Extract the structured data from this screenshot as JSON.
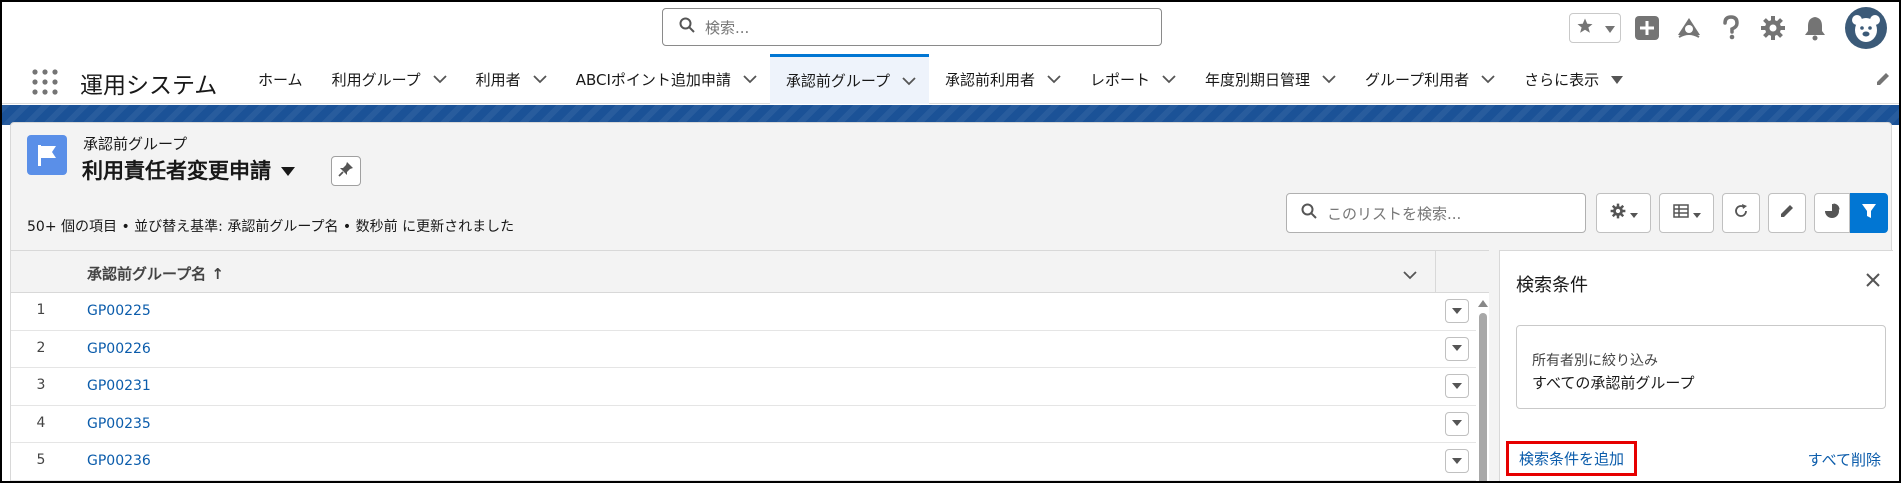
{
  "header": {
    "search_placeholder": "検索...",
    "icons": [
      "favorites-star-icon",
      "chevron-down-icon",
      "add-icon",
      "trailhead-icon",
      "help-icon",
      "setup-gear-icon",
      "notification-bell-icon",
      "avatar-icon"
    ]
  },
  "nav": {
    "app_name": "運用システム",
    "tabs": [
      {
        "label": "ホーム",
        "has_menu": false
      },
      {
        "label": "利用グループ",
        "has_menu": true
      },
      {
        "label": "利用者",
        "has_menu": true
      },
      {
        "label": "ABCIポイント追加申請",
        "has_menu": true
      },
      {
        "label": "承認前グループ",
        "has_menu": true,
        "active": true
      },
      {
        "label": "承認前利用者",
        "has_menu": true
      },
      {
        "label": "レポート",
        "has_menu": true
      },
      {
        "label": "年度別期日管理",
        "has_menu": true
      },
      {
        "label": "グループ利用者",
        "has_menu": true
      }
    ],
    "more_label": "さらに表示"
  },
  "list": {
    "object_label": "承認前グループ",
    "title": "利用責任者変更申請",
    "meta": "50+ 個の項目 • 並び替え基準: 承認前グループ名 • 数秒前 に更新されました",
    "search_placeholder": "このリストを検索...",
    "column_header": "承認前グループ名 ↑",
    "rows": [
      {
        "num": "1",
        "name": "GP00225"
      },
      {
        "num": "2",
        "name": "GP00226"
      },
      {
        "num": "3",
        "name": "GP00231"
      },
      {
        "num": "4",
        "name": "GP00235"
      },
      {
        "num": "5",
        "name": "GP00236"
      }
    ]
  },
  "filter_panel": {
    "title": "検索条件",
    "owner_label": "所有者別に絞り込み",
    "owner_value": "すべての承認前グループ",
    "add_filter": "検索条件を追加",
    "remove_all": "すべて削除"
  },
  "colors": {
    "brand": "#0176d3",
    "link": "#0b5cab",
    "band": "#1b5297",
    "highlight": "#e60000"
  }
}
